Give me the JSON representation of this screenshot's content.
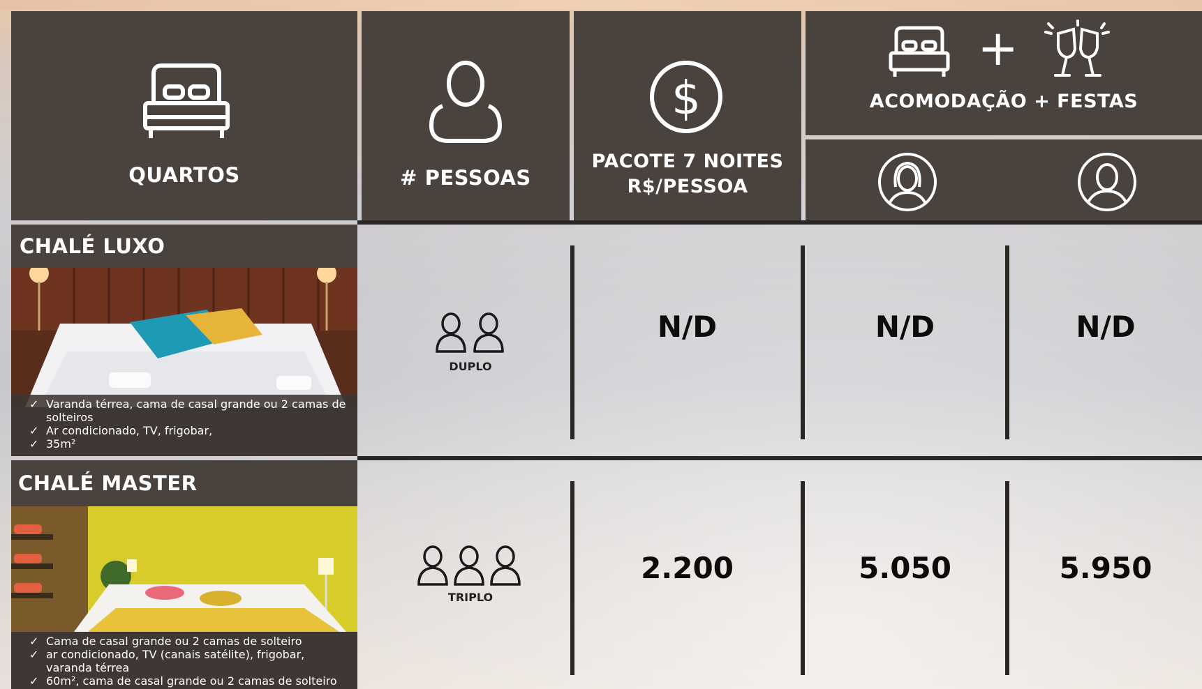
{
  "header": {
    "rooms_label": "QUARTOS",
    "people_label": "# PESSOAS",
    "package_line1": "PACOTE 7 NOITES",
    "package_line2": "R$/PESSOA",
    "combo_label": "ACOMODAÇÃO + FESTAS",
    "plus_sign": "+",
    "icons": [
      "bed-icon",
      "person-icon",
      "dollar-coin-icon",
      "bed-icon",
      "plus-icon",
      "champagne-toast-icon",
      "woman-avatar-icon",
      "man-avatar-icon"
    ]
  },
  "rooms": [
    {
      "name": "CHALÉ LUXO",
      "features": [
        "Varanda térrea, cama de casal grande ou 2 camas de solteiros",
        "Ar condicionado, TV, frigobar,",
        "35m²"
      ],
      "occupancy": "DUPLO",
      "package_price": "N/D",
      "price_female": "N/D",
      "price_male": "N/D"
    },
    {
      "name": "CHALÉ MASTER",
      "features": [
        "Cama de casal grande ou 2 camas de solteiro",
        "ar condicionado, TV (canais satélite), frigobar, varanda térrea",
        "60m², cama de casal grande ou 2 camas de solteiro"
      ],
      "occupancy": "TRIPLO",
      "package_price": "2.200",
      "price_female": "5.050",
      "price_male": "5.950"
    }
  ],
  "colors": {
    "panel": "#4a423d",
    "divider": "#2a2624",
    "text_dark": "#0e0c0b"
  }
}
